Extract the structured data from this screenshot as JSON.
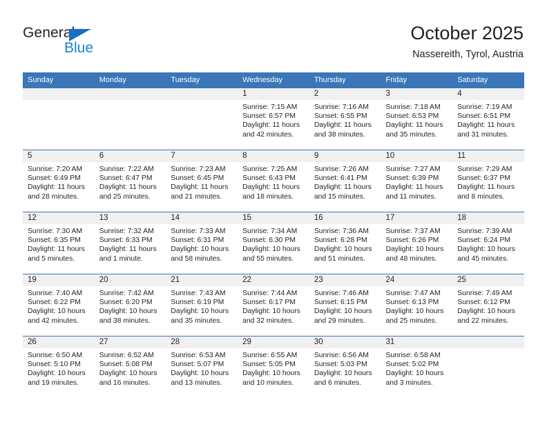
{
  "brand": {
    "name_part1": "General",
    "name_part2": "Blue",
    "triangle_color": "#1b6ec2",
    "blue_text_color": "#1b7fd4"
  },
  "header": {
    "title": "October 2025",
    "subtitle": "Nassereith, Tyrol, Austria"
  },
  "theme": {
    "header_row_bg": "#3a76b8",
    "daynum_band_bg": "#f0f0f0",
    "text_color": "#231f20"
  },
  "weekday_headers": [
    "Sunday",
    "Monday",
    "Tuesday",
    "Wednesday",
    "Thursday",
    "Friday",
    "Saturday"
  ],
  "weeks": [
    [
      {
        "empty": true
      },
      {
        "empty": true
      },
      {
        "empty": true
      },
      {
        "day": "1",
        "sunrise": "Sunrise: 7:15 AM",
        "sunset": "Sunset: 6:57 PM",
        "daylight1": "Daylight: 11 hours",
        "daylight2": "and 42 minutes."
      },
      {
        "day": "2",
        "sunrise": "Sunrise: 7:16 AM",
        "sunset": "Sunset: 6:55 PM",
        "daylight1": "Daylight: 11 hours",
        "daylight2": "and 38 minutes."
      },
      {
        "day": "3",
        "sunrise": "Sunrise: 7:18 AM",
        "sunset": "Sunset: 6:53 PM",
        "daylight1": "Daylight: 11 hours",
        "daylight2": "and 35 minutes."
      },
      {
        "day": "4",
        "sunrise": "Sunrise: 7:19 AM",
        "sunset": "Sunset: 6:51 PM",
        "daylight1": "Daylight: 11 hours",
        "daylight2": "and 31 minutes."
      }
    ],
    [
      {
        "day": "5",
        "sunrise": "Sunrise: 7:20 AM",
        "sunset": "Sunset: 6:49 PM",
        "daylight1": "Daylight: 11 hours",
        "daylight2": "and 28 minutes."
      },
      {
        "day": "6",
        "sunrise": "Sunrise: 7:22 AM",
        "sunset": "Sunset: 6:47 PM",
        "daylight1": "Daylight: 11 hours",
        "daylight2": "and 25 minutes."
      },
      {
        "day": "7",
        "sunrise": "Sunrise: 7:23 AM",
        "sunset": "Sunset: 6:45 PM",
        "daylight1": "Daylight: 11 hours",
        "daylight2": "and 21 minutes."
      },
      {
        "day": "8",
        "sunrise": "Sunrise: 7:25 AM",
        "sunset": "Sunset: 6:43 PM",
        "daylight1": "Daylight: 11 hours",
        "daylight2": "and 18 minutes."
      },
      {
        "day": "9",
        "sunrise": "Sunrise: 7:26 AM",
        "sunset": "Sunset: 6:41 PM",
        "daylight1": "Daylight: 11 hours",
        "daylight2": "and 15 minutes."
      },
      {
        "day": "10",
        "sunrise": "Sunrise: 7:27 AM",
        "sunset": "Sunset: 6:39 PM",
        "daylight1": "Daylight: 11 hours",
        "daylight2": "and 11 minutes."
      },
      {
        "day": "11",
        "sunrise": "Sunrise: 7:29 AM",
        "sunset": "Sunset: 6:37 PM",
        "daylight1": "Daylight: 11 hours",
        "daylight2": "and 8 minutes."
      }
    ],
    [
      {
        "day": "12",
        "sunrise": "Sunrise: 7:30 AM",
        "sunset": "Sunset: 6:35 PM",
        "daylight1": "Daylight: 11 hours",
        "daylight2": "and 5 minutes."
      },
      {
        "day": "13",
        "sunrise": "Sunrise: 7:32 AM",
        "sunset": "Sunset: 6:33 PM",
        "daylight1": "Daylight: 11 hours",
        "daylight2": "and 1 minute."
      },
      {
        "day": "14",
        "sunrise": "Sunrise: 7:33 AM",
        "sunset": "Sunset: 6:31 PM",
        "daylight1": "Daylight: 10 hours",
        "daylight2": "and 58 minutes."
      },
      {
        "day": "15",
        "sunrise": "Sunrise: 7:34 AM",
        "sunset": "Sunset: 6:30 PM",
        "daylight1": "Daylight: 10 hours",
        "daylight2": "and 55 minutes."
      },
      {
        "day": "16",
        "sunrise": "Sunrise: 7:36 AM",
        "sunset": "Sunset: 6:28 PM",
        "daylight1": "Daylight: 10 hours",
        "daylight2": "and 51 minutes."
      },
      {
        "day": "17",
        "sunrise": "Sunrise: 7:37 AM",
        "sunset": "Sunset: 6:26 PM",
        "daylight1": "Daylight: 10 hours",
        "daylight2": "and 48 minutes."
      },
      {
        "day": "18",
        "sunrise": "Sunrise: 7:39 AM",
        "sunset": "Sunset: 6:24 PM",
        "daylight1": "Daylight: 10 hours",
        "daylight2": "and 45 minutes."
      }
    ],
    [
      {
        "day": "19",
        "sunrise": "Sunrise: 7:40 AM",
        "sunset": "Sunset: 6:22 PM",
        "daylight1": "Daylight: 10 hours",
        "daylight2": "and 42 minutes."
      },
      {
        "day": "20",
        "sunrise": "Sunrise: 7:42 AM",
        "sunset": "Sunset: 6:20 PM",
        "daylight1": "Daylight: 10 hours",
        "daylight2": "and 38 minutes."
      },
      {
        "day": "21",
        "sunrise": "Sunrise: 7:43 AM",
        "sunset": "Sunset: 6:19 PM",
        "daylight1": "Daylight: 10 hours",
        "daylight2": "and 35 minutes."
      },
      {
        "day": "22",
        "sunrise": "Sunrise: 7:44 AM",
        "sunset": "Sunset: 6:17 PM",
        "daylight1": "Daylight: 10 hours",
        "daylight2": "and 32 minutes."
      },
      {
        "day": "23",
        "sunrise": "Sunrise: 7:46 AM",
        "sunset": "Sunset: 6:15 PM",
        "daylight1": "Daylight: 10 hours",
        "daylight2": "and 29 minutes."
      },
      {
        "day": "24",
        "sunrise": "Sunrise: 7:47 AM",
        "sunset": "Sunset: 6:13 PM",
        "daylight1": "Daylight: 10 hours",
        "daylight2": "and 25 minutes."
      },
      {
        "day": "25",
        "sunrise": "Sunrise: 7:49 AM",
        "sunset": "Sunset: 6:12 PM",
        "daylight1": "Daylight: 10 hours",
        "daylight2": "and 22 minutes."
      }
    ],
    [
      {
        "day": "26",
        "sunrise": "Sunrise: 6:50 AM",
        "sunset": "Sunset: 5:10 PM",
        "daylight1": "Daylight: 10 hours",
        "daylight2": "and 19 minutes."
      },
      {
        "day": "27",
        "sunrise": "Sunrise: 6:52 AM",
        "sunset": "Sunset: 5:08 PM",
        "daylight1": "Daylight: 10 hours",
        "daylight2": "and 16 minutes."
      },
      {
        "day": "28",
        "sunrise": "Sunrise: 6:53 AM",
        "sunset": "Sunset: 5:07 PM",
        "daylight1": "Daylight: 10 hours",
        "daylight2": "and 13 minutes."
      },
      {
        "day": "29",
        "sunrise": "Sunrise: 6:55 AM",
        "sunset": "Sunset: 5:05 PM",
        "daylight1": "Daylight: 10 hours",
        "daylight2": "and 10 minutes."
      },
      {
        "day": "30",
        "sunrise": "Sunrise: 6:56 AM",
        "sunset": "Sunset: 5:03 PM",
        "daylight1": "Daylight: 10 hours",
        "daylight2": "and 6 minutes."
      },
      {
        "day": "31",
        "sunrise": "Sunrise: 6:58 AM",
        "sunset": "Sunset: 5:02 PM",
        "daylight1": "Daylight: 10 hours",
        "daylight2": "and 3 minutes."
      },
      {
        "empty": true
      }
    ]
  ]
}
